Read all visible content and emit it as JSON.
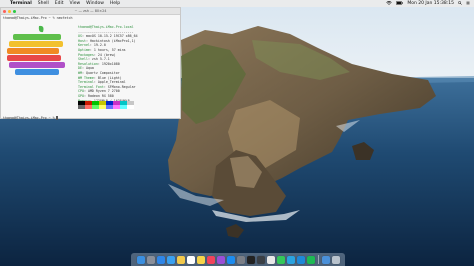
{
  "menubar": {
    "apple_glyph": "",
    "app_name": "Terminal",
    "items": [
      "Shell",
      "Edit",
      "View",
      "Window",
      "Help"
    ],
    "status": {
      "wifi_icon": "wifi-icon",
      "battery_icon": "battery-icon",
      "clock": "Mon 20 Jan 15:38:15"
    }
  },
  "terminal": {
    "title": "~ — zsh — 80×24",
    "prompt_top": "thaead@Thaiys-iMac-Pro ~ % neofetch",
    "user_host": "thaead@Thaiys-iMac-Pro.local",
    "separator": "----------------------------",
    "info": [
      {
        "key": "OS",
        "value": "macOS 10.15.2 19C57 x86_64"
      },
      {
        "key": "Host",
        "value": "Hackintosh (iMacPro1,1)"
      },
      {
        "key": "Kernel",
        "value": "19.2.0"
      },
      {
        "key": "Uptime",
        "value": "1 hours, 57 mins"
      },
      {
        "key": "Packages",
        "value": "24 (brew)"
      },
      {
        "key": "Shell",
        "value": "zsh 5.7.1"
      },
      {
        "key": "Resolution",
        "value": "1920x1080"
      },
      {
        "key": "DE",
        "value": "Aqua"
      },
      {
        "key": "WM",
        "value": "Quartz Compositor"
      },
      {
        "key": "WM Theme",
        "value": "Blue (Light)"
      },
      {
        "key": "Terminal",
        "value": "Apple_Terminal"
      },
      {
        "key": "Terminal Font",
        "value": "SFMono-Regular"
      },
      {
        "key": "CPU",
        "value": "AMD Ryzen 7 2700"
      },
      {
        "key": "GPU",
        "value": "Radeon RX 580"
      },
      {
        "key": "Memory",
        "value": "1738MiB / 16384MiB"
      }
    ],
    "palette": [
      "#000000",
      "#c91b00",
      "#00c200",
      "#c7c400",
      "#0225c7",
      "#c930c7",
      "#00c5c7",
      "#c7c7c7",
      "#686868",
      "#ff6e67",
      "#5ffa68",
      "#fffc67",
      "#6871ff",
      "#ff77ff",
      "#60fdff",
      "#ffffff"
    ],
    "prompt_bottom": "thaead@Thaiys-iMac-Pro ~ %"
  },
  "dock": {
    "apps": [
      {
        "name": "finder-icon",
        "color": "#3b8fe0"
      },
      {
        "name": "launchpad-icon",
        "color": "#8a8f9a"
      },
      {
        "name": "safari-icon",
        "color": "#2f86e8"
      },
      {
        "name": "mail-icon",
        "color": "#3aa0f0"
      },
      {
        "name": "photos-icon",
        "color": "#f2c94c"
      },
      {
        "name": "calendar-icon",
        "color": "#ffffff"
      },
      {
        "name": "notes-icon",
        "color": "#f6d44a"
      },
      {
        "name": "music-icon",
        "color": "#f0445c"
      },
      {
        "name": "podcasts-icon",
        "color": "#9b4fd6"
      },
      {
        "name": "appstore-icon",
        "color": "#1c8cf0"
      },
      {
        "name": "system-preferences-icon",
        "color": "#7b7f87"
      },
      {
        "name": "terminal-icon",
        "color": "#222222"
      },
      {
        "name": "activity-monitor-icon",
        "color": "#3a3f45"
      },
      {
        "name": "chrome-icon",
        "color": "#e8e8e8"
      },
      {
        "name": "whatsapp-icon",
        "color": "#34c759"
      },
      {
        "name": "telegram-icon",
        "color": "#2aa3e0"
      },
      {
        "name": "vscode-icon",
        "color": "#1e88d8"
      },
      {
        "name": "spotify-icon",
        "color": "#1db954"
      }
    ],
    "right": [
      {
        "name": "downloads-icon",
        "color": "#4a90d9"
      },
      {
        "name": "trash-icon",
        "color": "#b9c3cd"
      }
    ]
  }
}
